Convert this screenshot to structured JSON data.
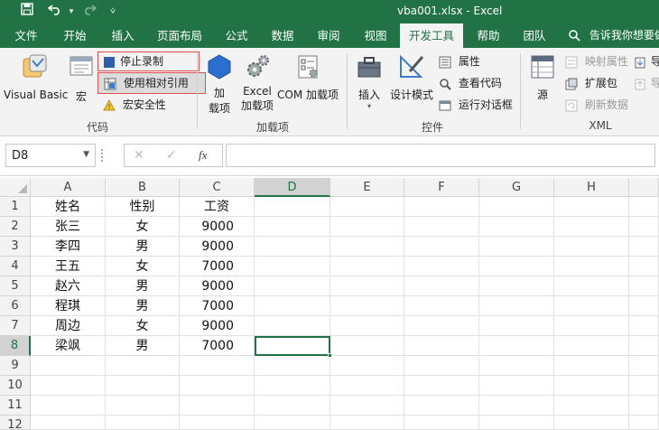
{
  "titlebar": {
    "title": "vba001.xlsx  -  Excel",
    "icons": [
      "save-icon",
      "undo-icon",
      "redo-icon",
      "customize-icon"
    ]
  },
  "tabs": [
    {
      "label": "文件",
      "active": false
    },
    {
      "label": "开始",
      "active": false
    },
    {
      "label": "插入",
      "active": false
    },
    {
      "label": "页面布局",
      "active": false
    },
    {
      "label": "公式",
      "active": false
    },
    {
      "label": "数据",
      "active": false
    },
    {
      "label": "审阅",
      "active": false
    },
    {
      "label": "视图",
      "active": false
    },
    {
      "label": "开发工具",
      "active": true
    },
    {
      "label": "帮助",
      "active": false
    },
    {
      "label": "团队",
      "active": false
    }
  ],
  "tell_me": "告诉我你想要做",
  "ribbon": {
    "code": {
      "visual_basic": "Visual Basic",
      "macro": "宏",
      "stop_recording": "停止录制",
      "relative_refs": "使用相对引用",
      "macro_security": "宏安全性",
      "group": "代码"
    },
    "addins": {
      "add_line1": "加",
      "add_line2": "载项",
      "excel_line1": "Excel",
      "excel_line2": "加载项",
      "com": "COM 加载项",
      "group": "加载项"
    },
    "controls": {
      "insert": "插入",
      "design_mode": "设计模式",
      "properties": "属性",
      "view_code": "查看代码",
      "run_dialog": "运行对话框",
      "group": "控件"
    },
    "xml": {
      "source": "源",
      "map_properties": "映射属性",
      "expansion_packs": "扩展包",
      "refresh_data": "刷新数据",
      "import": "导",
      "export": "导",
      "group": "XML"
    }
  },
  "formula_bar": {
    "name_box": "D8",
    "cancel": "✕",
    "enter": "✓",
    "fx": "fx",
    "formula": ""
  },
  "sheet": {
    "columns": [
      "A",
      "B",
      "C",
      "D",
      "E",
      "F",
      "G",
      "H"
    ],
    "rows": [
      "1",
      "2",
      "3",
      "4",
      "5",
      "6",
      "7",
      "8",
      "9",
      "10",
      "11",
      "12"
    ],
    "selected_cell": "D8",
    "cells": [
      [
        "姓名",
        "性别",
        "工资"
      ],
      [
        "张三",
        "女",
        "9000"
      ],
      [
        "李四",
        "男",
        "9000"
      ],
      [
        "王五",
        "女",
        "7000"
      ],
      [
        "赵六",
        "男",
        "9000"
      ],
      [
        "程琪",
        "男",
        "7000"
      ],
      [
        "周边",
        "女",
        "9000"
      ],
      [
        "梁飒",
        "男",
        "7000"
      ]
    ]
  },
  "colors": {
    "excel_green": "#217346",
    "highlight_red": "#e05050",
    "ribbon_bg": "#f3f3f3"
  }
}
